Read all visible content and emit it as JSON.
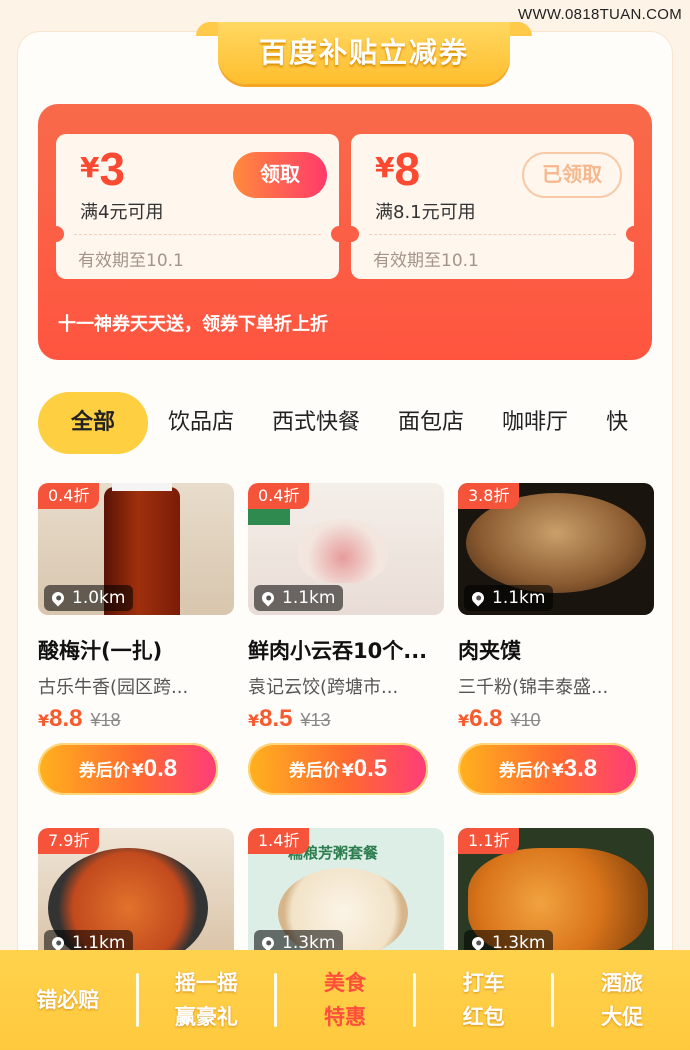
{
  "watermark": "WWW.0818TUAN.COM",
  "banner": {
    "title": "百度补贴立减券"
  },
  "coupons": [
    {
      "currency": "¥",
      "amount": "3",
      "condition": "满4元可用",
      "validity": "有效期至10.1",
      "button": "领取",
      "claimed": false
    },
    {
      "currency": "¥",
      "amount": "8",
      "condition": "满8.1元可用",
      "validity": "有效期至10.1",
      "button": "已领取",
      "claimed": true
    }
  ],
  "coupon_slogan": "十一神券天天送，领券下单折上折",
  "tabs": [
    "全部",
    "饮品店",
    "西式快餐",
    "面包店",
    "咖啡厅",
    "快"
  ],
  "active_tab": "全部",
  "products": [
    {
      "discount": "0.4折",
      "distance": "1.0km",
      "title": "酸梅汁(一扎)",
      "shop": "古乐牛香(园区跨...",
      "currency": "¥",
      "price": "8.8",
      "original": "¥18",
      "after_label": "券后价",
      "after_currency": "¥",
      "after_price": "0.8"
    },
    {
      "discount": "0.4折",
      "distance": "1.1km",
      "title": "鲜肉小云吞10个...",
      "shop": "袁记云饺(跨塘市...",
      "currency": "¥",
      "price": "8.5",
      "original": "¥13",
      "after_label": "券后价",
      "after_currency": "¥",
      "after_price": "0.5"
    },
    {
      "discount": "3.8折",
      "distance": "1.1km",
      "title": "肉夹馍",
      "shop": "三千粉(锦丰泰盛...",
      "currency": "¥",
      "price": "6.8",
      "original": "¥10",
      "after_label": "券后价",
      "after_currency": "¥",
      "after_price": "3.8"
    },
    {
      "discount": "7.9折",
      "distance": "1.1km"
    },
    {
      "discount": "1.4折",
      "distance": "1.3km",
      "image_text": "糯粮芳粥套餐"
    },
    {
      "discount": "1.1折",
      "distance": "1.3km"
    }
  ],
  "bottom_nav": [
    {
      "line1": "错必赔",
      "line2": ""
    },
    {
      "line1": "摇一摇",
      "line2": "赢豪礼"
    },
    {
      "line1": "美食",
      "line2": "特惠"
    },
    {
      "line1": "打车",
      "line2": "红包"
    },
    {
      "line1": "酒旅",
      "line2": "大促"
    }
  ],
  "colors": {
    "accent_red": "#ff5540",
    "accent_yellow": "#ffc93d",
    "price_orange": "#f65a2d"
  }
}
